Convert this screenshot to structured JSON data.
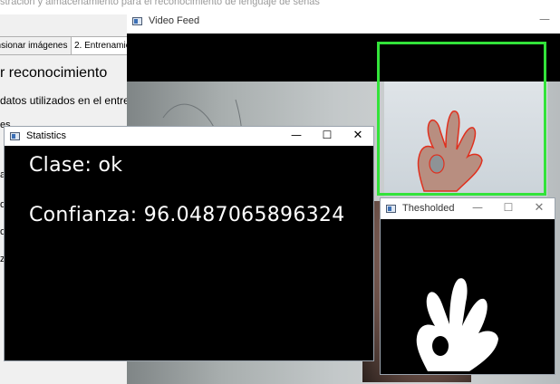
{
  "background_app": {
    "title": "stración y almacenamiento para el reconocimiento de lenguaje de señas",
    "tabs": [
      "ensionar imágenes",
      "2. Entrenamie"
    ],
    "heading": "r reconocimiento",
    "text": "datos utilizados en el entre",
    "fragments": [
      "es",
      "o",
      "o",
      "a",
      "z"
    ]
  },
  "video_window": {
    "title": "Video Feed",
    "controls": {
      "minimize": "—"
    }
  },
  "stats_window": {
    "title": "Statistics",
    "controls": {
      "minimize": "—",
      "maximize": "☐",
      "close": "✕"
    },
    "class_text": "Clase: ok",
    "confidence_text": "Confianza: 96.0487065896324"
  },
  "thresh_window": {
    "title": "Thesholded",
    "controls": {
      "minimize": "—",
      "maximize": "☐",
      "close": "✕"
    }
  },
  "colors": {
    "bbox": "#33e33a",
    "contour": "#e0301e"
  },
  "icons": {
    "window_icon": "window-app-icon"
  }
}
